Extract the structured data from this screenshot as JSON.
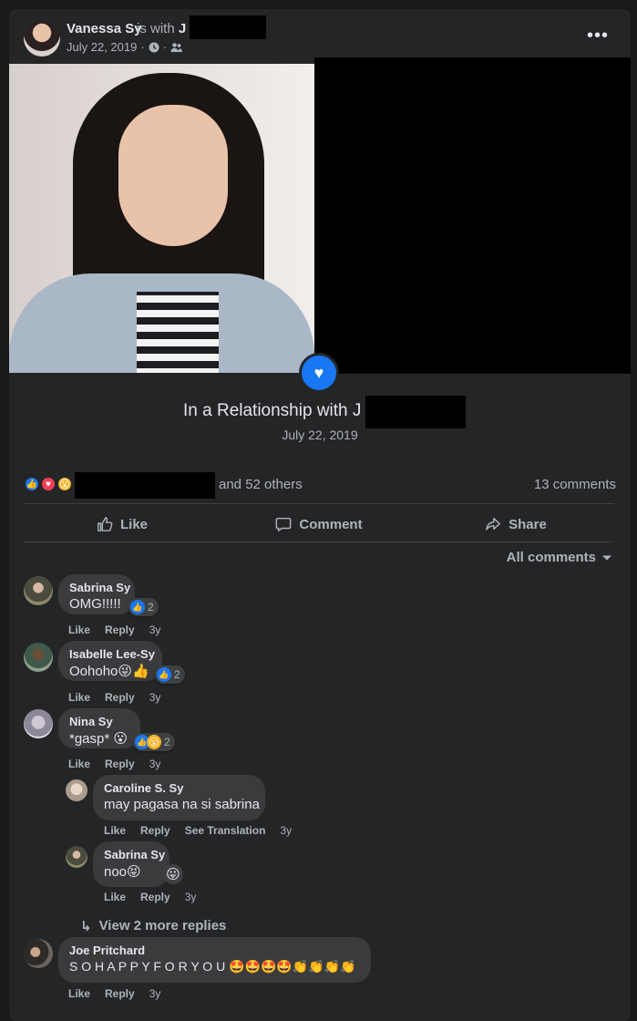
{
  "post": {
    "author": "Vanessa Sy",
    "with_text": "is with",
    "with_initial": "J",
    "date": "July 22, 2019",
    "separator": "·",
    "privacy_icon": "friends-icon",
    "more_icon": "more-horizontal-icon",
    "relationship_title": "In a Relationship with J",
    "relationship_date": "July 22, 2019"
  },
  "reactions": {
    "icons": [
      "like-icon",
      "love-icon",
      "wow-icon"
    ],
    "others_text": "and 52 others",
    "comments_count": "13 comments"
  },
  "actions": {
    "like": "Like",
    "comment": "Comment",
    "share": "Share"
  },
  "filter": {
    "label": "All comments"
  },
  "comment_actions": {
    "like": "Like",
    "reply": "Reply",
    "see_translation": "See Translation"
  },
  "comments": [
    {
      "name": "Sabrina Sy",
      "text": "OMG!!!!!",
      "reaction_count": "2",
      "time": "3y"
    },
    {
      "name": "Isabelle Lee-Sy",
      "text": "Oohoho😜👍",
      "reaction_count": "2",
      "time": "3y"
    },
    {
      "name": "Nina Sy",
      "text": "*gasp* 😮",
      "reaction_count": "2",
      "time": "3y"
    },
    {
      "name": "Caroline S. Sy",
      "text": "may pagasa na si sabrina",
      "time": "3y"
    },
    {
      "name": "Sabrina Sy",
      "text": "noo😝",
      "time": "3y",
      "reaction_emoji": "😛"
    },
    {
      "name": "Joe Pritchard",
      "text": "S O H A P P Y F O R Y O U 🤩🤩🤩🤩👏👏👏👏",
      "time": "3y"
    }
  ],
  "view_more": "View 2 more replies",
  "colors": {
    "background": "#18191a",
    "card": "#242526",
    "bubble": "#3a3b3c",
    "text_primary": "#e4e6eb",
    "text_secondary": "#b0b3b8",
    "accent": "#1877f2",
    "love": "#f33e58",
    "wow": "#f7b125"
  }
}
